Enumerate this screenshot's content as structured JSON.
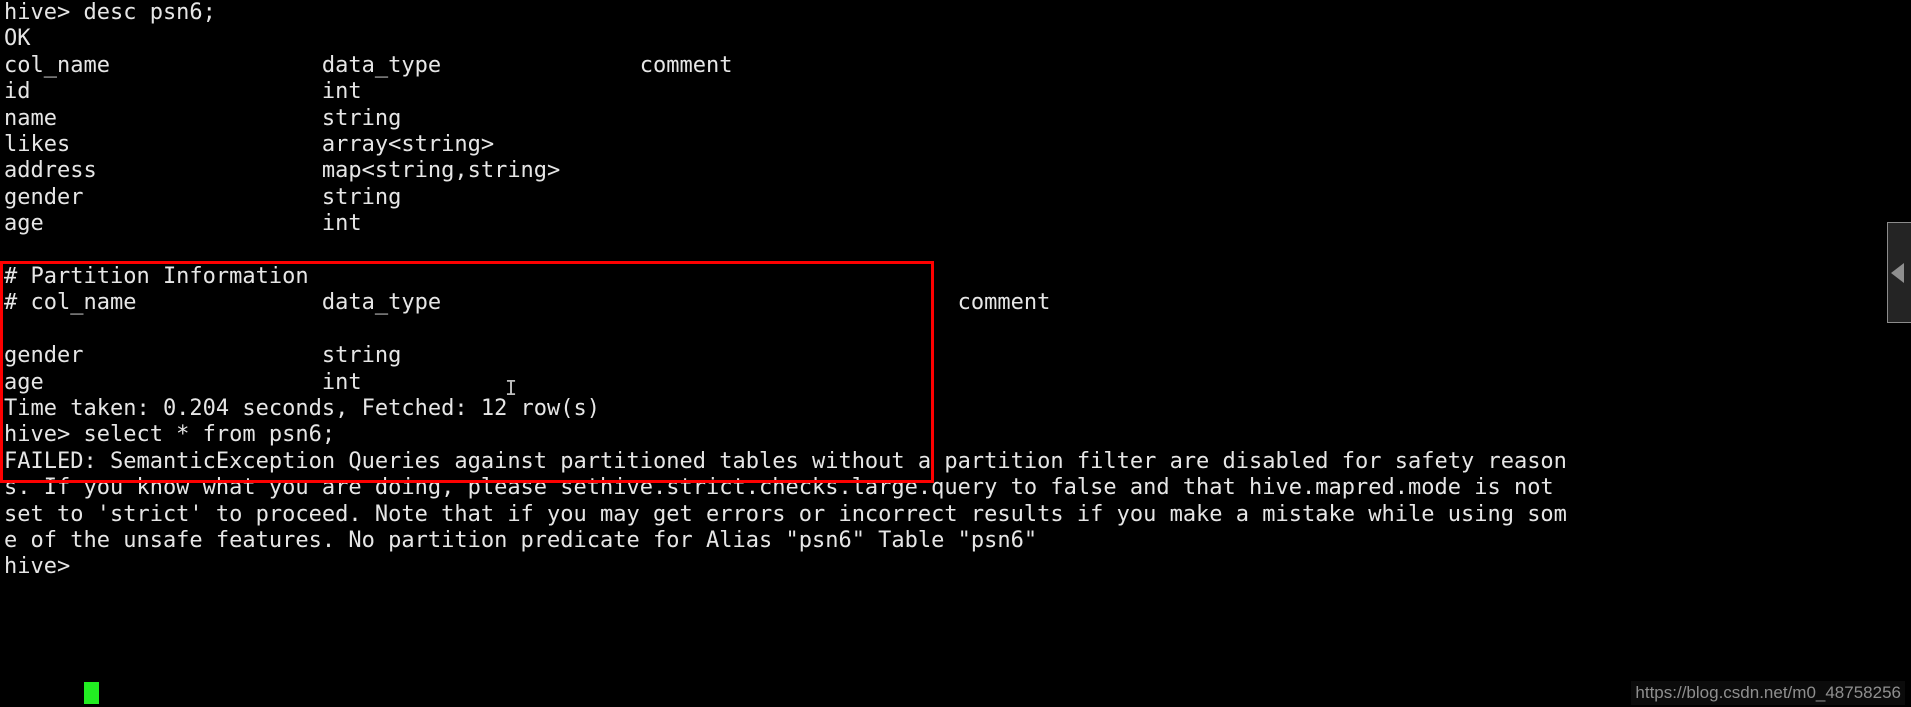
{
  "terminal": {
    "background_color": "#000000",
    "text_color": "#e6e6e6",
    "cursor_color": "#22ee22",
    "highlight_color": "#fe0000",
    "prompt": "hive>",
    "lines": [
      {
        "id": "cmd-desc",
        "text": "hive> desc psn6;"
      },
      {
        "id": "status-ok",
        "text": "OK"
      },
      {
        "id": "schema-header",
        "text": "col_name            \tdata_type           \tcomment"
      },
      {
        "id": "schema-row-id",
        "text": "id                  \tint"
      },
      {
        "id": "schema-row-name",
        "text": "name                \tstring"
      },
      {
        "id": "schema-row-likes",
        "text": "likes               \tarray<string>"
      },
      {
        "id": "schema-row-address",
        "text": "address             \tmap<string,string>"
      },
      {
        "id": "schema-row-gender",
        "text": "gender              \tstring"
      },
      {
        "id": "schema-row-age",
        "text": "age                 \tint"
      },
      {
        "id": "blank-1",
        "text": ""
      },
      {
        "id": "partition-title",
        "text": "# Partition Information"
      },
      {
        "id": "partition-header",
        "text": "# col_name            \tdata_type               \tcomment"
      },
      {
        "id": "blank-2",
        "text": ""
      },
      {
        "id": "partition-gender",
        "text": "gender                \tstring"
      },
      {
        "id": "partition-age",
        "text": "age                   \tint"
      },
      {
        "id": "time-taken",
        "text": "Time taken: 0.204 seconds, Fetched: 12 row(s)"
      },
      {
        "id": "cmd-select",
        "text": "hive> select * from psn6;"
      },
      {
        "id": "error-line-1",
        "text": "FAILED: SemanticException Queries against partitioned tables without a partition filter are disabled for safety reason"
      },
      {
        "id": "error-line-2",
        "text": "s. If you know what you are doing, please sethive.strict.checks.large.query to false and that hive.mapred.mode is not"
      },
      {
        "id": "error-line-3",
        "text": "set to 'strict' to proceed. Note that if you may get errors or incorrect results if you make a mistake while using som"
      },
      {
        "id": "error-line-4",
        "text": "e of the unsafe features. No partition predicate for Alias \"psn6\" Table \"psn6\""
      },
      {
        "id": "prompt-final",
        "text": "hive>"
      }
    ]
  },
  "schema": {
    "columns": [
      "col_name",
      "data_type",
      "comment"
    ],
    "rows": [
      {
        "col_name": "id",
        "data_type": "int",
        "comment": ""
      },
      {
        "col_name": "name",
        "data_type": "string",
        "comment": ""
      },
      {
        "col_name": "likes",
        "data_type": "array<string>",
        "comment": ""
      },
      {
        "col_name": "address",
        "data_type": "map<string,string>",
        "comment": ""
      },
      {
        "col_name": "gender",
        "data_type": "string",
        "comment": ""
      },
      {
        "col_name": "age",
        "data_type": "int",
        "comment": ""
      }
    ]
  },
  "partition_info": {
    "title": "# Partition Information",
    "columns": [
      "# col_name",
      "data_type",
      "comment"
    ],
    "rows": [
      {
        "col_name": "gender",
        "data_type": "string",
        "comment": ""
      },
      {
        "col_name": "age",
        "data_type": "int",
        "comment": ""
      }
    ]
  },
  "result": {
    "time_taken": "Time taken: 0.204 seconds, Fetched: 12 row(s)",
    "seconds": "0.204",
    "fetched_rows": "12"
  },
  "side_panel": {
    "icon": "triangle-left-icon"
  },
  "watermark": {
    "text": "https://blog.csdn.net/m0_48758256"
  }
}
